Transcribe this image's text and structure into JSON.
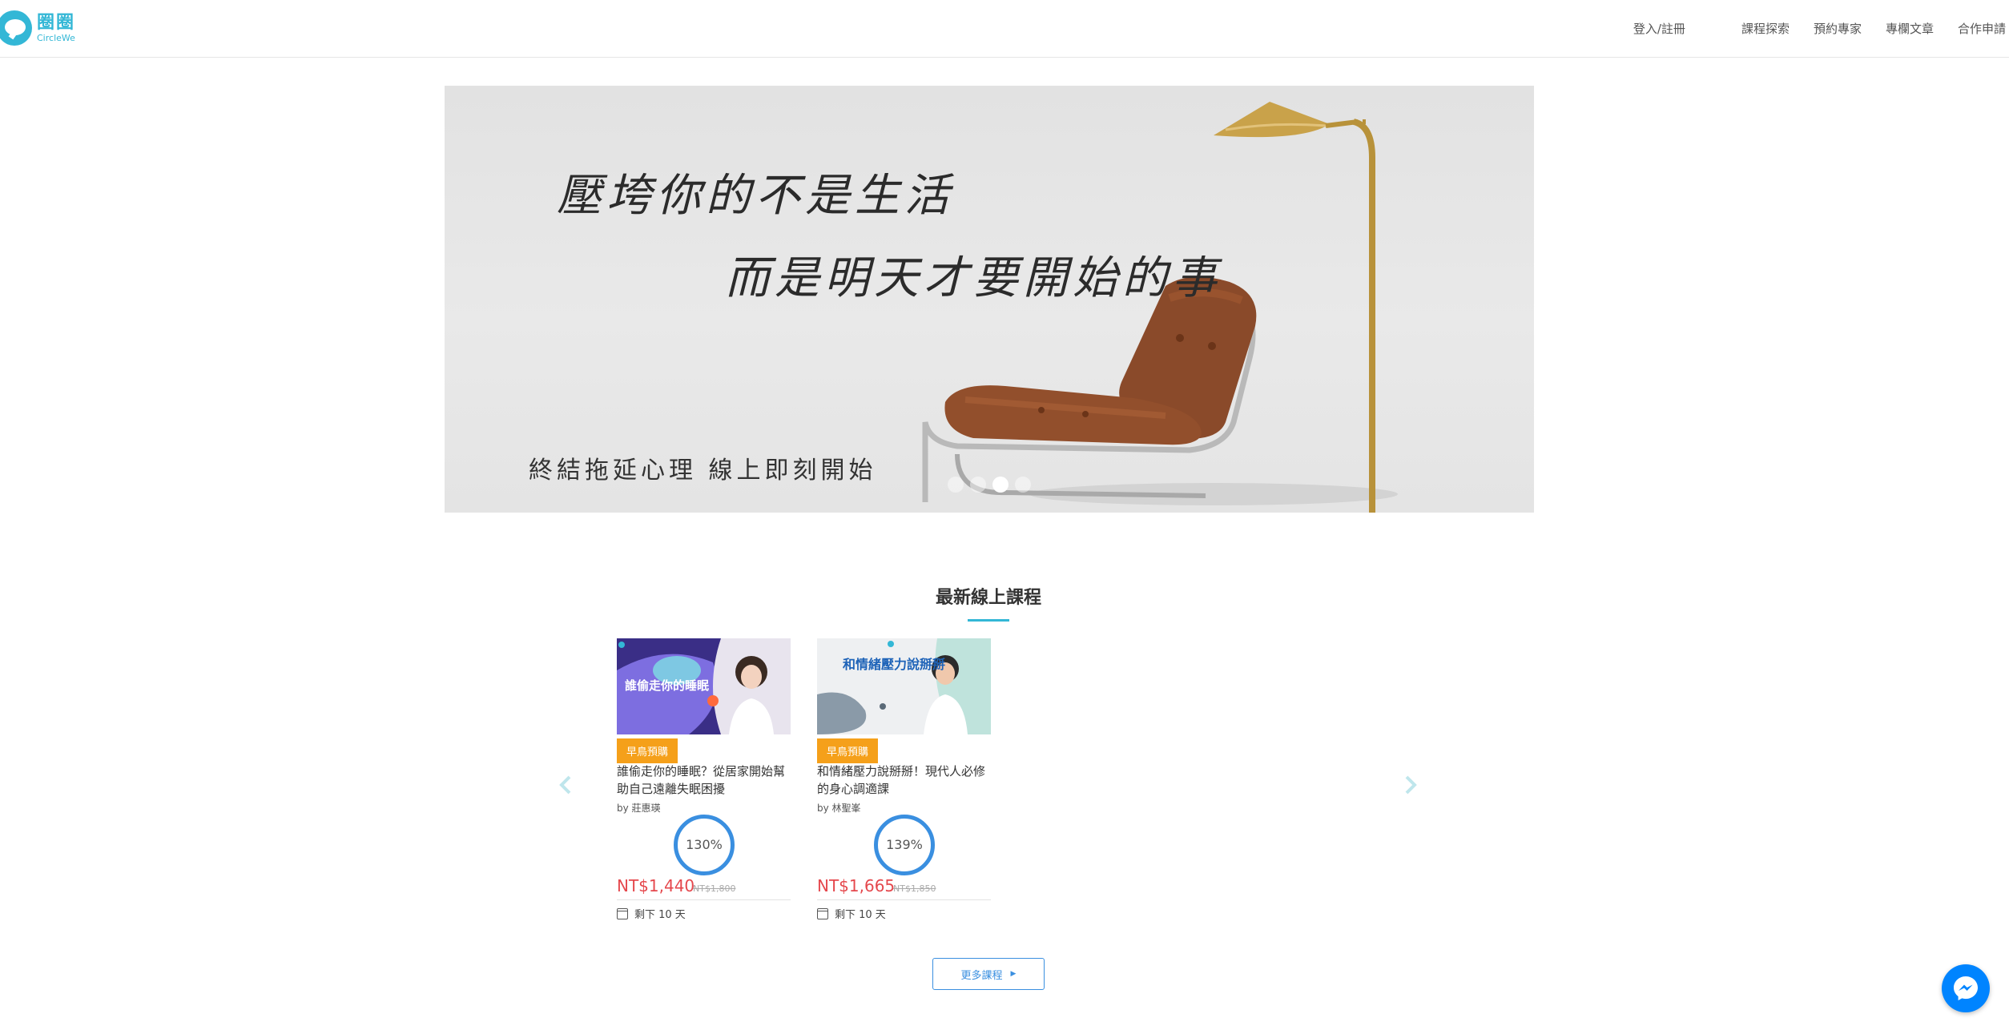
{
  "header": {
    "logo_cn": "圈圈",
    "logo_en": "CircleWe",
    "nav": {
      "login": "登入/註冊",
      "explore": "課程探索",
      "booking": "預約專家",
      "articles": "專欄文章",
      "partner": "合作申請"
    }
  },
  "hero": {
    "line1": "壓垮你的不是生活",
    "line2": "而是明天才要開始的事",
    "caption": "終結拖延心理 線上即刻開始",
    "slides": 4,
    "active_slide": 3
  },
  "courses": {
    "section_title": "最新線上課程",
    "items": [
      {
        "badge": "早鳥預購",
        "thumb_title": "誰偷走你的睡眠",
        "title": "誰偷走你的睡眠？從居家開始幫助自己遠離失眠困擾",
        "by": "by 莊惠瑛",
        "progress": "130%",
        "price": "NT$1,440",
        "original_price": "NT$1,800",
        "remaining": "剩下 10 天"
      },
      {
        "badge": "早鳥預購",
        "thumb_title": "和情緒壓力說掰掰",
        "title": "和情緒壓力說掰掰！現代人必修的身心調適課",
        "by": "by 林聖峯",
        "progress": "139%",
        "price": "NT$1,665",
        "original_price": "NT$1,850",
        "remaining": "剩下 10 天"
      }
    ],
    "more_button": "更多課程"
  },
  "colors": {
    "brand": "#33b7d6",
    "accent": "#3a8fe0",
    "badge": "#f5a01a",
    "price": "#e5484d",
    "messenger": "#0084ff"
  }
}
